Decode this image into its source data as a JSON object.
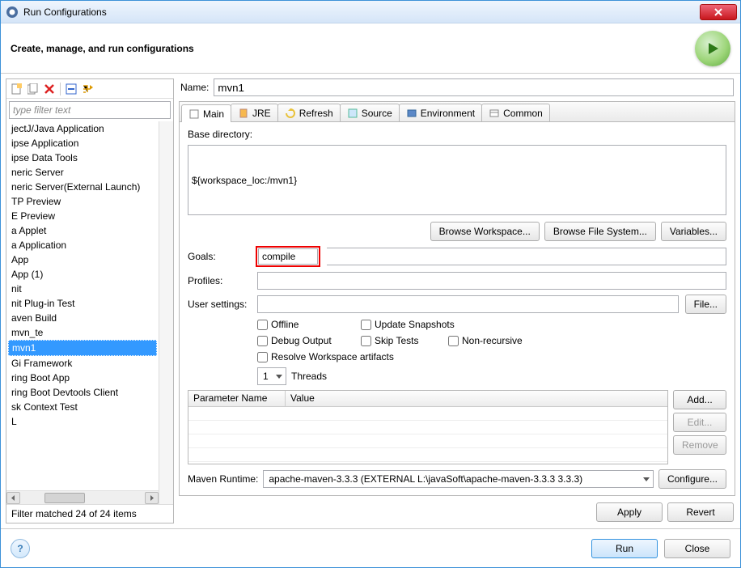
{
  "window": {
    "title": "Run Configurations"
  },
  "header": {
    "text": "Create, manage, and run configurations"
  },
  "left": {
    "filter_placeholder": "type filter text",
    "items": [
      "jectJ/Java Application",
      "ipse Application",
      "ipse Data Tools",
      "neric Server",
      "neric Server(External Launch)",
      "TP Preview",
      "E Preview",
      "a Applet",
      "a Application",
      "App",
      "App (1)",
      "nit",
      "nit Plug-in Test",
      "aven Build",
      "mvn_te",
      "mvn1",
      "Gi Framework",
      "ring Boot App",
      "ring Boot Devtools Client",
      "sk Context Test",
      "L"
    ],
    "selected_index": 15,
    "status": "Filter matched 24 of 24 items"
  },
  "main": {
    "name_label": "Name:",
    "name_value": "mvn1",
    "tabs": [
      {
        "label": "Main"
      },
      {
        "label": "JRE"
      },
      {
        "label": "Refresh"
      },
      {
        "label": "Source"
      },
      {
        "label": "Environment"
      },
      {
        "label": "Common"
      }
    ],
    "active_tab": 0,
    "base_directory_label": "Base directory:",
    "base_directory_value": "${workspace_loc:/mvn1}",
    "browse_workspace": "Browse Workspace...",
    "browse_filesystem": "Browse File System...",
    "variables": "Variables...",
    "goals_label": "Goals:",
    "goals_value": "compile",
    "profiles_label": "Profiles:",
    "profiles_value": "",
    "user_settings_label": "User settings:",
    "user_settings_value": "",
    "file_button": "File...",
    "checks": {
      "offline": "Offline",
      "update_snapshots": "Update Snapshots",
      "debug_output": "Debug Output",
      "skip_tests": "Skip Tests",
      "non_recursive": "Non-recursive",
      "resolve_workspace": "Resolve Workspace artifacts"
    },
    "threads_value": "1",
    "threads_label": "Threads",
    "param_table": {
      "col1": "Parameter Name",
      "col2": "Value"
    },
    "param_buttons": {
      "add": "Add...",
      "edit": "Edit...",
      "remove": "Remove"
    },
    "runtime_label": "Maven Runtime:",
    "runtime_value": "apache-maven-3.3.3 (EXTERNAL L:\\javaSoft\\apache-maven-3.3.3 3.3.3)",
    "configure": "Configure...",
    "apply": "Apply",
    "revert": "Revert"
  },
  "footer": {
    "run": "Run",
    "close": "Close"
  }
}
